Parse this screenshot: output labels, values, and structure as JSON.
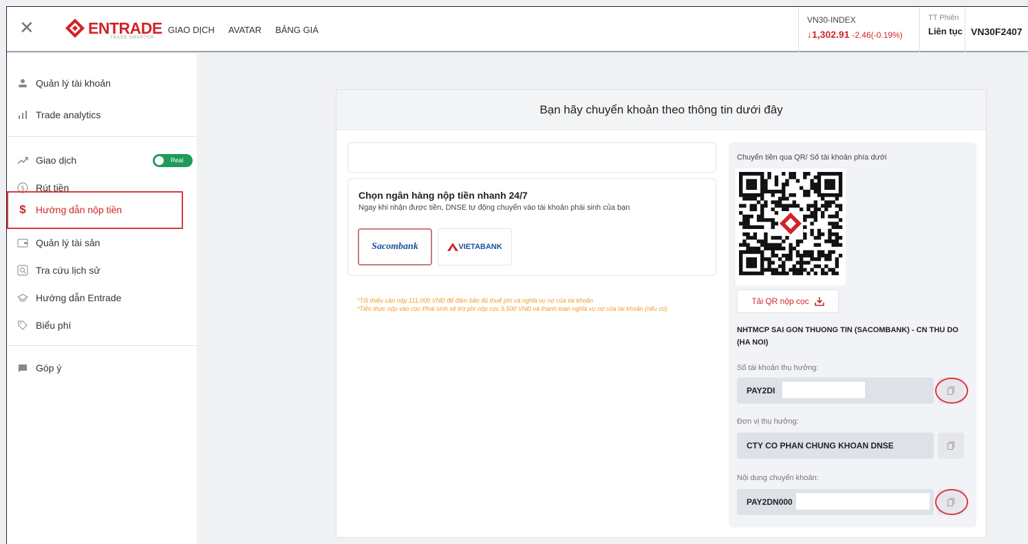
{
  "header": {
    "logo_text": "ENTRADE",
    "logo_sub": "TRADE SMARTER",
    "nav": [
      "GIAO DỊCH",
      "AVATAR",
      "BẢNG GIÁ"
    ],
    "index_label": "VN30-INDEX",
    "index_value": "↓1,302.91",
    "index_change": "-2.46(-0.19%)",
    "session_label": "TT Phiên",
    "session_value": "Liên tục",
    "contract": "VN30F2407"
  },
  "sidebar": {
    "items": [
      {
        "label": "Quản lý tài khoản"
      },
      {
        "label": "Trade analytics"
      },
      {
        "label": "Giao dịch"
      },
      {
        "label": "Rút tiền"
      },
      {
        "label": "Hướng dẫn nộp tiền"
      },
      {
        "label": "Quản lý tài sản"
      },
      {
        "label": "Tra cứu lịch sử"
      },
      {
        "label": "Hướng dẫn Entrade"
      },
      {
        "label": "Biểu phí"
      },
      {
        "label": "Góp ý"
      }
    ],
    "toggle_label": "Real"
  },
  "main": {
    "title": "Bạn hãy chuyển khoản theo thông tin dưới đây",
    "bank_select_title": "Chọn ngân hàng nộp tiền nhanh 24/7",
    "bank_select_desc": "Ngay khi nhận được tiền, DNSE tự động chuyển vào tài khoản phái sinh của bạn",
    "banks": [
      "Sacombank",
      "VIETABANK"
    ],
    "notes": [
      "*Tối thiểu cần nộp 111,000 VNĐ để đảm bảo đủ thuế phí và nghĩa vụ nợ của tài khoản",
      "*Tiền thực nộp vào cọc Phái sinh sẽ trừ phí nộp cọc 5,500 VNĐ và thanh toán nghĩa vụ nợ của tài khoản (nếu có)"
    ]
  },
  "transfer": {
    "qr_caption": "Chuyển tiền qua QR/ Số tài khoản phía dưới",
    "download_label": "Tải QR nộp cọc",
    "bank_name": "NHTMCP SAI GON THUONG TIN (SACOMBANK) - CN THU DO (HA NOI)",
    "account_label": "Số tài khoản thụ hưởng:",
    "account_value": "PAY2DI",
    "beneficiary_label": "Đơn vị thụ hưởng:",
    "beneficiary_value": "CTY CO PHAN CHUNG KHOAN DNSE",
    "content_label": "Nội dung chuyển khoản:",
    "content_value": "PAY2DN000"
  },
  "colors": {
    "brand": "#d2232a",
    "toggle": "#1e9b5a",
    "highlight": "#d9363e"
  }
}
